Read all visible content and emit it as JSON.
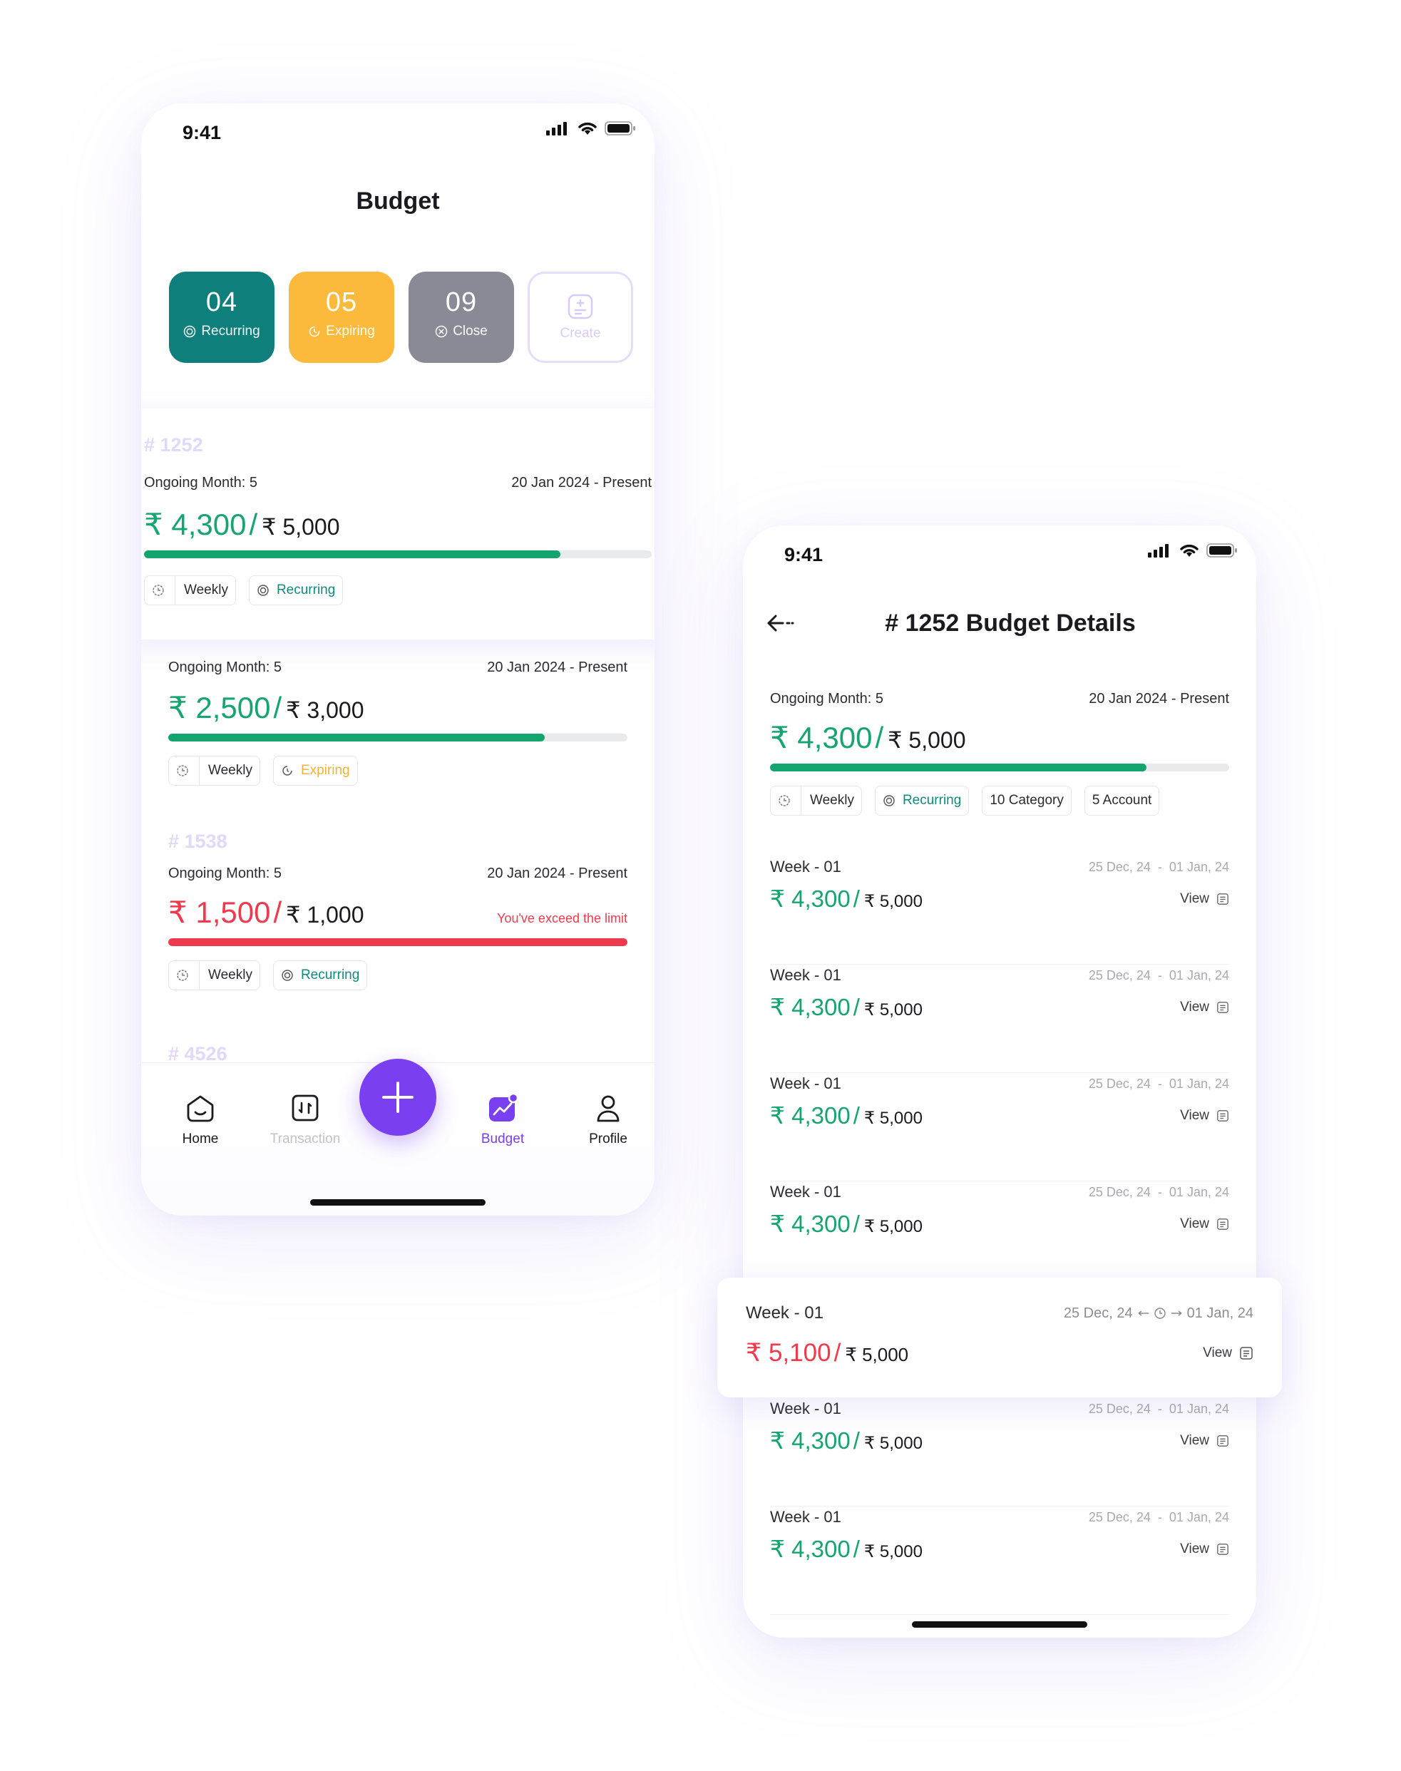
{
  "colors": {
    "accent": "#7B3FF2",
    "green": "#16A571",
    "red": "#EF3A4E",
    "teal": "#0F7F7B",
    "orange": "#FBBA3C",
    "gray": "#8A8A96"
  },
  "budget_screen": {
    "status_time": "9:41",
    "title": "Budget",
    "stats": [
      {
        "value": "04",
        "label": "Recurring",
        "color": "#0F7F7B",
        "icon": "recurring-icon"
      },
      {
        "value": "05",
        "label": "Expiring",
        "color": "#FBBA3C",
        "icon": "expiring-icon"
      },
      {
        "value": "09",
        "label": "Close",
        "color": "#8A8A96",
        "icon": "close-circle-icon"
      }
    ],
    "create_label": "Create",
    "cards": [
      {
        "id": "# 1252",
        "ongoing": "Ongoing Month: 5",
        "date": "20 Jan 2024 - Present",
        "spent": "₹ 4,300",
        "sep": "/",
        "limit": "₹ 5,000",
        "progress": 0.82,
        "tag1": "Weekly",
        "tag2": "Recurring"
      },
      {
        "ongoing": "Ongoing Month: 5",
        "date": "20 Jan 2024 - Present",
        "spent": "₹ 2,500",
        "sep": "/",
        "limit": "₹ 3,000",
        "progress": 0.82,
        "tag1": "Weekly",
        "tag2": "Expiring"
      },
      {
        "id": "# 1538",
        "ongoing": "Ongoing Month: 5",
        "date": "20 Jan 2024 - Present",
        "spent": "₹ 1,500",
        "sep": "/",
        "limit": "₹ 1,000",
        "progress": 1.0,
        "warning": "You've exceed the limit",
        "tag1": "Weekly",
        "tag2": "Recurring"
      },
      {
        "id": "# 4526"
      }
    ],
    "nav": {
      "home": "Home",
      "transaction": "Transaction",
      "budget": "Budget",
      "profile": "Profile"
    }
  },
  "details_screen": {
    "status_time": "9:41",
    "title": "# 1252 Budget Details",
    "summary": {
      "ongoing": "Ongoing Month: 5",
      "date": "20 Jan 2024 - Present",
      "spent": "₹ 4,300",
      "sep": "/",
      "limit": "₹ 5,000",
      "progress": 0.82,
      "tags": [
        "Weekly",
        "Recurring",
        "10 Category",
        "5 Account"
      ]
    },
    "weeks": [
      {
        "name": "Week - 01",
        "date": "25 Dec, 24  -  01 Jan, 24",
        "spent": "₹ 4,300",
        "sep": "/",
        "limit": "₹ 5,000",
        "view": "View"
      },
      {
        "name": "Week - 01",
        "date": "25 Dec, 24  -  01 Jan, 24",
        "spent": "₹ 4,300",
        "sep": "/",
        "limit": "₹ 5,000",
        "view": "View"
      },
      {
        "name": "Week - 01",
        "date": "25 Dec, 24  -  01 Jan, 24",
        "spent": "₹ 4,300",
        "sep": "/",
        "limit": "₹ 5,000",
        "view": "View"
      },
      {
        "name": "Week - 01",
        "date": "25 Dec, 24  -  01 Jan, 24",
        "spent": "₹ 4,300",
        "sep": "/",
        "limit": "₹ 5,000",
        "view": "View"
      },
      {
        "name": "Week - 01",
        "date": "25 Dec, 24  -  01 Jan, 24",
        "spent": "₹ 4,300",
        "sep": "/",
        "limit": "₹ 5,000",
        "view": "View"
      },
      {
        "name": "Week - 01",
        "date": "25 Dec, 24  -  01 Jan, 24",
        "spent": "₹ 4,300",
        "sep": "/",
        "limit": "₹ 5,000",
        "view": "View"
      }
    ],
    "highlight": {
      "name": "Week - 01",
      "date_from": "25 Dec, 24",
      "date_to": "01 Jan, 24",
      "spent": "₹ 5,100",
      "sep": "/",
      "limit": "₹ 5,000",
      "view": "View"
    }
  }
}
